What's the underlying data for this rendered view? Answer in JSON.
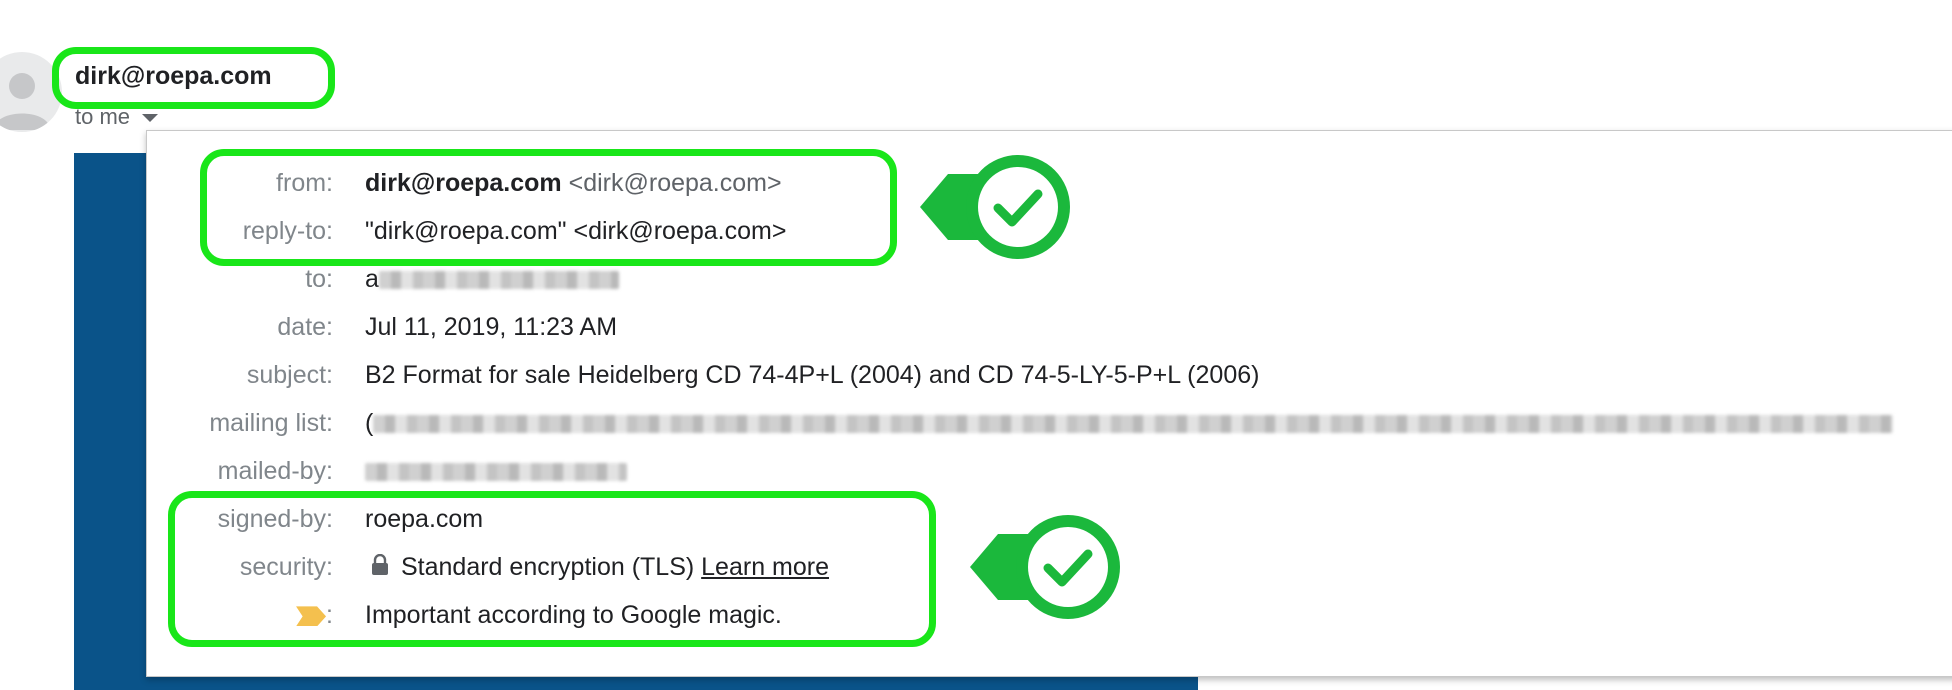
{
  "header": {
    "sender": "dirk@roepa.com",
    "recipient_summary": "to me"
  },
  "details": {
    "from": {
      "label": "from:",
      "name": "dirk@roepa.com",
      "address": "<dirk@roepa.com>"
    },
    "reply_to": {
      "label": "reply-to:",
      "value": "\"dirk@roepa.com\" <dirk@roepa.com>"
    },
    "to": {
      "label": "to:",
      "value_visible": "a",
      "value_redacted": true
    },
    "date": {
      "label": "date:",
      "value": "Jul 11, 2019, 11:23 AM"
    },
    "subject": {
      "label": "subject:",
      "value": "B2 Format for sale Heidelberg CD 74-4P+L (2004) and CD 74-5-LY-5-P+L (2006)"
    },
    "mailing_list": {
      "label": "mailing list:",
      "value_visible": "(",
      "value_redacted": true
    },
    "mailed_by": {
      "label": "mailed-by:",
      "value_redacted": true
    },
    "signed_by": {
      "label": "signed-by:",
      "value": "roepa.com"
    },
    "security": {
      "label": "security:",
      "value": "Standard encryption (TLS)",
      "link": "Learn more"
    },
    "importance": {
      "label": ":",
      "value": "Important according to Google magic."
    }
  },
  "colors": {
    "highlight": "#19e619",
    "badge_green": "#1bb83c",
    "blue_band": "#0a5389",
    "importance_marker": "#f4c04e"
  },
  "icons": [
    "person-avatar-icon",
    "chevron-down-icon",
    "lock-icon",
    "importance-marker-icon",
    "check-icon"
  ]
}
